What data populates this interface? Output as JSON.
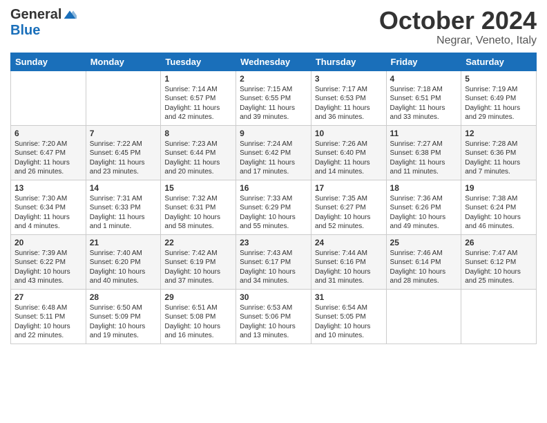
{
  "header": {
    "logo": {
      "general": "General",
      "blue": "Blue"
    },
    "title": "October 2024",
    "location": "Negrar, Veneto, Italy"
  },
  "weekdays": [
    "Sunday",
    "Monday",
    "Tuesday",
    "Wednesday",
    "Thursday",
    "Friday",
    "Saturday"
  ],
  "weeks": [
    [
      {
        "day": "",
        "sunrise": "",
        "sunset": "",
        "daylight": ""
      },
      {
        "day": "",
        "sunrise": "",
        "sunset": "",
        "daylight": ""
      },
      {
        "day": "1",
        "sunrise": "Sunrise: 7:14 AM",
        "sunset": "Sunset: 6:57 PM",
        "daylight": "Daylight: 11 hours and 42 minutes."
      },
      {
        "day": "2",
        "sunrise": "Sunrise: 7:15 AM",
        "sunset": "Sunset: 6:55 PM",
        "daylight": "Daylight: 11 hours and 39 minutes."
      },
      {
        "day": "3",
        "sunrise": "Sunrise: 7:17 AM",
        "sunset": "Sunset: 6:53 PM",
        "daylight": "Daylight: 11 hours and 36 minutes."
      },
      {
        "day": "4",
        "sunrise": "Sunrise: 7:18 AM",
        "sunset": "Sunset: 6:51 PM",
        "daylight": "Daylight: 11 hours and 33 minutes."
      },
      {
        "day": "5",
        "sunrise": "Sunrise: 7:19 AM",
        "sunset": "Sunset: 6:49 PM",
        "daylight": "Daylight: 11 hours and 29 minutes."
      }
    ],
    [
      {
        "day": "6",
        "sunrise": "Sunrise: 7:20 AM",
        "sunset": "Sunset: 6:47 PM",
        "daylight": "Daylight: 11 hours and 26 minutes."
      },
      {
        "day": "7",
        "sunrise": "Sunrise: 7:22 AM",
        "sunset": "Sunset: 6:45 PM",
        "daylight": "Daylight: 11 hours and 23 minutes."
      },
      {
        "day": "8",
        "sunrise": "Sunrise: 7:23 AM",
        "sunset": "Sunset: 6:44 PM",
        "daylight": "Daylight: 11 hours and 20 minutes."
      },
      {
        "day": "9",
        "sunrise": "Sunrise: 7:24 AM",
        "sunset": "Sunset: 6:42 PM",
        "daylight": "Daylight: 11 hours and 17 minutes."
      },
      {
        "day": "10",
        "sunrise": "Sunrise: 7:26 AM",
        "sunset": "Sunset: 6:40 PM",
        "daylight": "Daylight: 11 hours and 14 minutes."
      },
      {
        "day": "11",
        "sunrise": "Sunrise: 7:27 AM",
        "sunset": "Sunset: 6:38 PM",
        "daylight": "Daylight: 11 hours and 11 minutes."
      },
      {
        "day": "12",
        "sunrise": "Sunrise: 7:28 AM",
        "sunset": "Sunset: 6:36 PM",
        "daylight": "Daylight: 11 hours and 7 minutes."
      }
    ],
    [
      {
        "day": "13",
        "sunrise": "Sunrise: 7:30 AM",
        "sunset": "Sunset: 6:34 PM",
        "daylight": "Daylight: 11 hours and 4 minutes."
      },
      {
        "day": "14",
        "sunrise": "Sunrise: 7:31 AM",
        "sunset": "Sunset: 6:33 PM",
        "daylight": "Daylight: 11 hours and 1 minute."
      },
      {
        "day": "15",
        "sunrise": "Sunrise: 7:32 AM",
        "sunset": "Sunset: 6:31 PM",
        "daylight": "Daylight: 10 hours and 58 minutes."
      },
      {
        "day": "16",
        "sunrise": "Sunrise: 7:33 AM",
        "sunset": "Sunset: 6:29 PM",
        "daylight": "Daylight: 10 hours and 55 minutes."
      },
      {
        "day": "17",
        "sunrise": "Sunrise: 7:35 AM",
        "sunset": "Sunset: 6:27 PM",
        "daylight": "Daylight: 10 hours and 52 minutes."
      },
      {
        "day": "18",
        "sunrise": "Sunrise: 7:36 AM",
        "sunset": "Sunset: 6:26 PM",
        "daylight": "Daylight: 10 hours and 49 minutes."
      },
      {
        "day": "19",
        "sunrise": "Sunrise: 7:38 AM",
        "sunset": "Sunset: 6:24 PM",
        "daylight": "Daylight: 10 hours and 46 minutes."
      }
    ],
    [
      {
        "day": "20",
        "sunrise": "Sunrise: 7:39 AM",
        "sunset": "Sunset: 6:22 PM",
        "daylight": "Daylight: 10 hours and 43 minutes."
      },
      {
        "day": "21",
        "sunrise": "Sunrise: 7:40 AM",
        "sunset": "Sunset: 6:20 PM",
        "daylight": "Daylight: 10 hours and 40 minutes."
      },
      {
        "day": "22",
        "sunrise": "Sunrise: 7:42 AM",
        "sunset": "Sunset: 6:19 PM",
        "daylight": "Daylight: 10 hours and 37 minutes."
      },
      {
        "day": "23",
        "sunrise": "Sunrise: 7:43 AM",
        "sunset": "Sunset: 6:17 PM",
        "daylight": "Daylight: 10 hours and 34 minutes."
      },
      {
        "day": "24",
        "sunrise": "Sunrise: 7:44 AM",
        "sunset": "Sunset: 6:16 PM",
        "daylight": "Daylight: 10 hours and 31 minutes."
      },
      {
        "day": "25",
        "sunrise": "Sunrise: 7:46 AM",
        "sunset": "Sunset: 6:14 PM",
        "daylight": "Daylight: 10 hours and 28 minutes."
      },
      {
        "day": "26",
        "sunrise": "Sunrise: 7:47 AM",
        "sunset": "Sunset: 6:12 PM",
        "daylight": "Daylight: 10 hours and 25 minutes."
      }
    ],
    [
      {
        "day": "27",
        "sunrise": "Sunrise: 6:48 AM",
        "sunset": "Sunset: 5:11 PM",
        "daylight": "Daylight: 10 hours and 22 minutes."
      },
      {
        "day": "28",
        "sunrise": "Sunrise: 6:50 AM",
        "sunset": "Sunset: 5:09 PM",
        "daylight": "Daylight: 10 hours and 19 minutes."
      },
      {
        "day": "29",
        "sunrise": "Sunrise: 6:51 AM",
        "sunset": "Sunset: 5:08 PM",
        "daylight": "Daylight: 10 hours and 16 minutes."
      },
      {
        "day": "30",
        "sunrise": "Sunrise: 6:53 AM",
        "sunset": "Sunset: 5:06 PM",
        "daylight": "Daylight: 10 hours and 13 minutes."
      },
      {
        "day": "31",
        "sunrise": "Sunrise: 6:54 AM",
        "sunset": "Sunset: 5:05 PM",
        "daylight": "Daylight: 10 hours and 10 minutes."
      },
      {
        "day": "",
        "sunrise": "",
        "sunset": "",
        "daylight": ""
      },
      {
        "day": "",
        "sunrise": "",
        "sunset": "",
        "daylight": ""
      }
    ]
  ]
}
